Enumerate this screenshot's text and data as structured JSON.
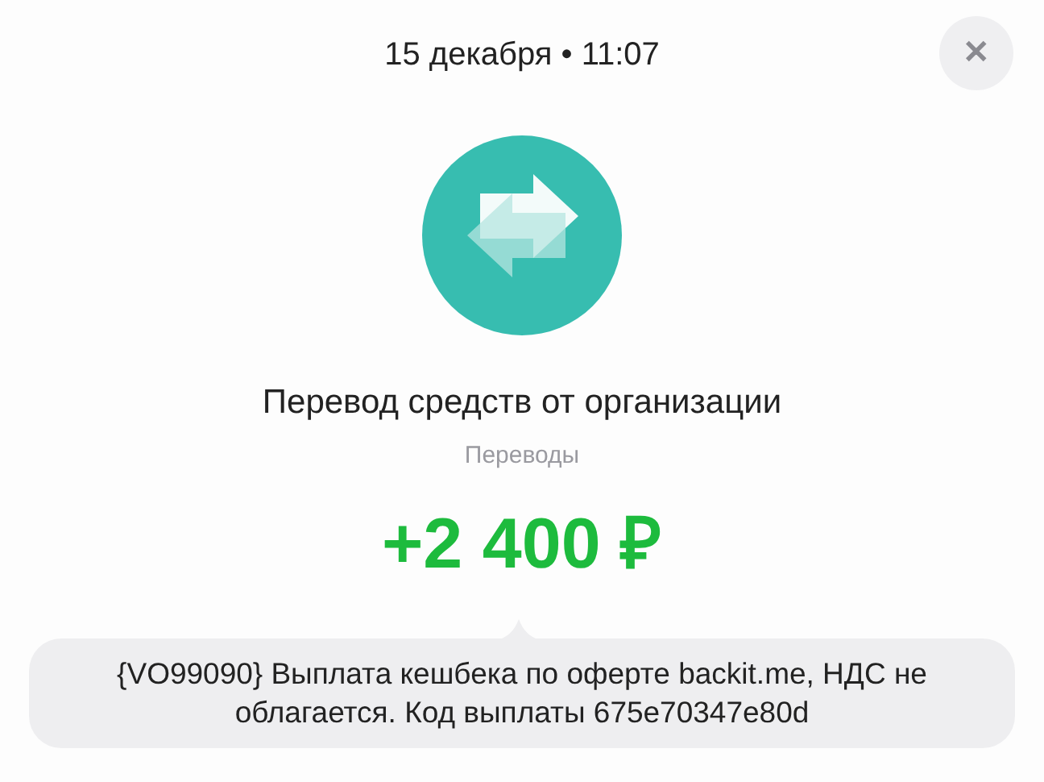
{
  "header": {
    "date": "15 декабря • 11:07",
    "close": "✕"
  },
  "operation": {
    "title": "Перевод средств от организации",
    "category": "Переводы",
    "amount": "+2 400 ₽"
  },
  "comment": {
    "text": "{VO99090} Выплата кешбека по оферте backit.me, НДС не облагается. Код выплаты 675e70347e80d"
  }
}
